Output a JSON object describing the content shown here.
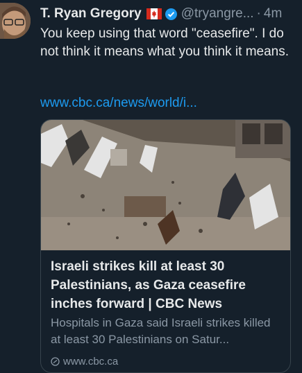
{
  "tweet": {
    "author_name": "T. Ryan Gregory",
    "handle": "@tryangre...",
    "separator": "·",
    "timestamp": "4m",
    "text": "You keep using that word \"ceasefire\". I do not think it means what you think it means.",
    "link": "www.cbc.ca/news/world/i..."
  },
  "card": {
    "title": "Israeli strikes kill at least 30 Palestinians, as Gaza ceasefire inches forward | CBC News",
    "description": "Hospitals in Gaza said Israeli strikes killed at least 30 Palestinians on Satur...",
    "domain": "www.cbc.ca"
  },
  "icons": {
    "flag": "canada-flag-icon",
    "verified": "verified-badge-icon",
    "link": "link-icon"
  },
  "colors": {
    "background": "#15202b",
    "link": "#1d9bf0",
    "muted": "#8b98a5",
    "verified": "#1d9bf0",
    "flag_red": "#d52b1e"
  }
}
